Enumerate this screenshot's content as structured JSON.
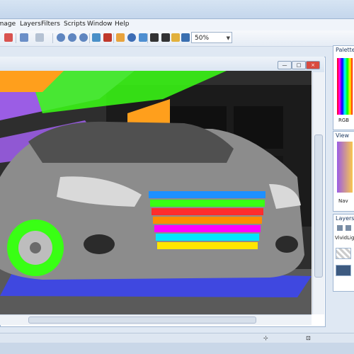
{
  "menu": [
    "Image",
    "Layers",
    "Filters",
    "Scripts",
    "Window",
    "Help"
  ],
  "toolbar": {
    "zoom_value": "50%"
  },
  "panels": {
    "palette": {
      "title": "Palette",
      "mode": "RGB"
    },
    "view": {
      "title": "View",
      "nav": "Nav"
    },
    "layers": {
      "title": "Layers",
      "blend": "VividLig"
    }
  },
  "colors": {
    "accent": "#4472c4",
    "canvas_green": "#39ff14",
    "canvas_purple": "#9b5de5",
    "canvas_orange": "#ff9f1c",
    "grille_colors": [
      "#1e90ff",
      "#39ff14",
      "#ff2d2d",
      "#ff8c00",
      "#ff00ff",
      "#00e5ff",
      "#ffe600"
    ]
  }
}
